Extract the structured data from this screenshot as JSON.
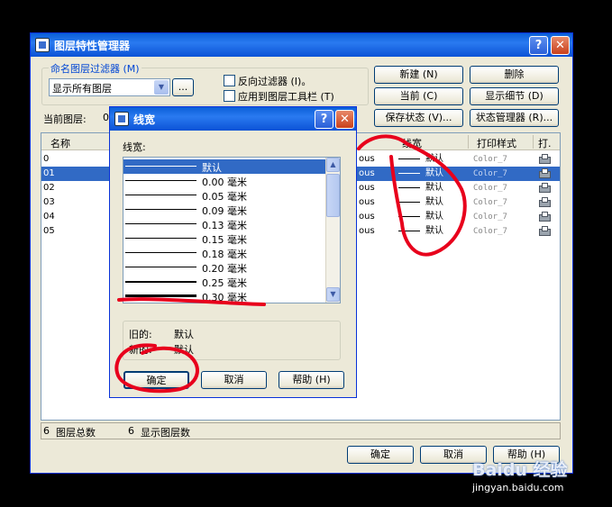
{
  "colors": {
    "titlebar": "#0a5fd8",
    "window_bg": "#ece9d8",
    "selection": "#316ac5",
    "annotation": "#e8001c"
  },
  "main_window": {
    "title": "图层特性管理器",
    "filter_group_label": "命名图层过滤器 (M)",
    "filter_value": "显示所有图层",
    "filter_more_button": "...",
    "invert_filter_label": "反向过滤器 (I)。",
    "apply_toolbar_label": "应用到图层工具栏 (T)",
    "current_layer_label": "当前图层:",
    "current_layer_value": "0",
    "buttons": {
      "new": "新建 (N)",
      "delete": "删除",
      "current": "当前 (C)",
      "show_details": "显示细节 (D)",
      "save_state": "保存状态 (V)...",
      "state_manager": "状态管理器 (R)..."
    },
    "table": {
      "col_name": "名称",
      "col_lineweight": "线宽",
      "col_plotstyle": "打印样式",
      "col_plot": "打.",
      "rows": [
        {
          "name": "0",
          "linetype": "ous",
          "lineweight": "默认",
          "plotstyle": "Color_7"
        },
        {
          "name": "01",
          "linetype": "ous",
          "lineweight": "默认",
          "plotstyle": "Color_7"
        },
        {
          "name": "02",
          "linetype": "ous",
          "lineweight": "默认",
          "plotstyle": "Color_7"
        },
        {
          "name": "03",
          "linetype": "ous",
          "lineweight": "默认",
          "plotstyle": "Color_7"
        },
        {
          "name": "04",
          "linetype": "ous",
          "lineweight": "默认",
          "plotstyle": "Color_7"
        },
        {
          "name": "05",
          "linetype": "ous",
          "lineweight": "默认",
          "plotstyle": "Color_7"
        }
      ]
    },
    "status": {
      "total_count": "6",
      "total_label": "图层总数",
      "shown_count": "6",
      "shown_label": "显示图层数"
    },
    "footer": {
      "ok": "确定",
      "cancel": "取消",
      "help": "帮助 (H)"
    }
  },
  "lineweight_dialog": {
    "title": "线宽",
    "list_label": "线宽:",
    "items": [
      {
        "label": "默认",
        "selected": true
      },
      {
        "label": "0.00 毫米"
      },
      {
        "label": "0.05 毫米"
      },
      {
        "label": "0.09 毫米"
      },
      {
        "label": "0.13 毫米"
      },
      {
        "label": "0.15 毫米"
      },
      {
        "label": "0.18 毫米"
      },
      {
        "label": "0.20 毫米"
      },
      {
        "label": "0.25 毫米"
      },
      {
        "label": "0.30 毫米"
      }
    ],
    "old_label": "旧的:",
    "old_value": "默认",
    "new_label": "新的:",
    "new_value": "默认",
    "ok": "确定",
    "cancel": "取消",
    "help": "帮助 (H)"
  },
  "watermark": {
    "brand": "Baidu 经验",
    "url": "jingyan.baidu.com"
  }
}
